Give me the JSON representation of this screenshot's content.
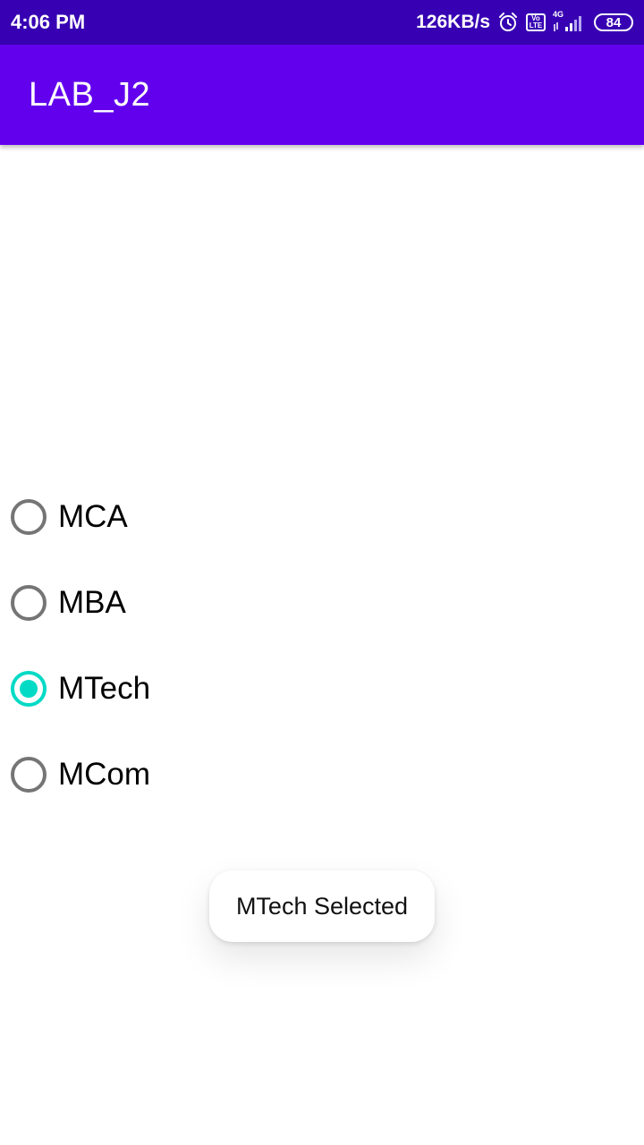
{
  "status_bar": {
    "time": "4:06 PM",
    "speed": "126KB/s",
    "volte_top": "Vo",
    "volte_bottom": "LTE",
    "network": "4G",
    "battery": "84",
    "icons": [
      "alarm-icon",
      "volte-icon",
      "signal-icon",
      "battery-icon"
    ]
  },
  "app_bar": {
    "title": "LAB_J2"
  },
  "radio_group": {
    "options": [
      {
        "label": "MCA",
        "checked": false
      },
      {
        "label": "MBA",
        "checked": false
      },
      {
        "label": "MTech",
        "checked": true
      },
      {
        "label": "MCom",
        "checked": false
      }
    ]
  },
  "toast": {
    "message": "MTech Selected"
  },
  "colors": {
    "status_bar": "#3700B3",
    "app_bar": "#6200EE",
    "radio_accent": "#03DAC5",
    "radio_unchecked": "#757575"
  }
}
